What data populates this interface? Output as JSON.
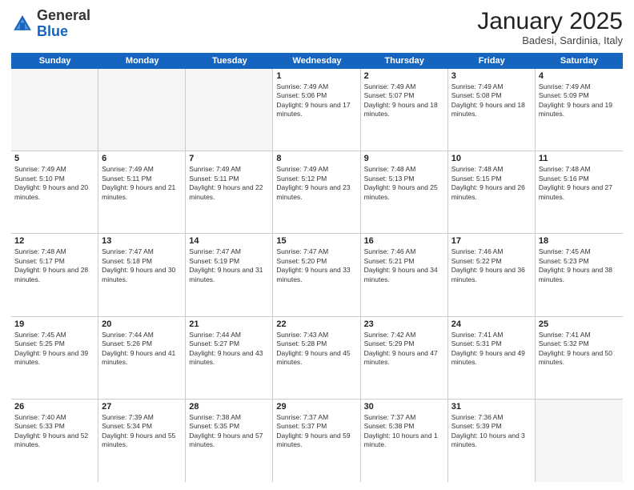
{
  "header": {
    "logo": {
      "general": "General",
      "blue": "Blue"
    },
    "month": "January 2025",
    "location": "Badesi, Sardinia, Italy"
  },
  "days": [
    "Sunday",
    "Monday",
    "Tuesday",
    "Wednesday",
    "Thursday",
    "Friday",
    "Saturday"
  ],
  "weeks": [
    [
      {
        "day": "",
        "empty": true
      },
      {
        "day": "",
        "empty": true
      },
      {
        "day": "",
        "empty": true
      },
      {
        "day": "1",
        "sunrise": "Sunrise: 7:49 AM",
        "sunset": "Sunset: 5:06 PM",
        "daylight": "Daylight: 9 hours and 17 minutes."
      },
      {
        "day": "2",
        "sunrise": "Sunrise: 7:49 AM",
        "sunset": "Sunset: 5:07 PM",
        "daylight": "Daylight: 9 hours and 18 minutes."
      },
      {
        "day": "3",
        "sunrise": "Sunrise: 7:49 AM",
        "sunset": "Sunset: 5:08 PM",
        "daylight": "Daylight: 9 hours and 18 minutes."
      },
      {
        "day": "4",
        "sunrise": "Sunrise: 7:49 AM",
        "sunset": "Sunset: 5:09 PM",
        "daylight": "Daylight: 9 hours and 19 minutes."
      }
    ],
    [
      {
        "day": "5",
        "sunrise": "Sunrise: 7:49 AM",
        "sunset": "Sunset: 5:10 PM",
        "daylight": "Daylight: 9 hours and 20 minutes."
      },
      {
        "day": "6",
        "sunrise": "Sunrise: 7:49 AM",
        "sunset": "Sunset: 5:11 PM",
        "daylight": "Daylight: 9 hours and 21 minutes."
      },
      {
        "day": "7",
        "sunrise": "Sunrise: 7:49 AM",
        "sunset": "Sunset: 5:11 PM",
        "daylight": "Daylight: 9 hours and 22 minutes."
      },
      {
        "day": "8",
        "sunrise": "Sunrise: 7:49 AM",
        "sunset": "Sunset: 5:12 PM",
        "daylight": "Daylight: 9 hours and 23 minutes."
      },
      {
        "day": "9",
        "sunrise": "Sunrise: 7:48 AM",
        "sunset": "Sunset: 5:13 PM",
        "daylight": "Daylight: 9 hours and 25 minutes."
      },
      {
        "day": "10",
        "sunrise": "Sunrise: 7:48 AM",
        "sunset": "Sunset: 5:15 PM",
        "daylight": "Daylight: 9 hours and 26 minutes."
      },
      {
        "day": "11",
        "sunrise": "Sunrise: 7:48 AM",
        "sunset": "Sunset: 5:16 PM",
        "daylight": "Daylight: 9 hours and 27 minutes."
      }
    ],
    [
      {
        "day": "12",
        "sunrise": "Sunrise: 7:48 AM",
        "sunset": "Sunset: 5:17 PM",
        "daylight": "Daylight: 9 hours and 28 minutes."
      },
      {
        "day": "13",
        "sunrise": "Sunrise: 7:47 AM",
        "sunset": "Sunset: 5:18 PM",
        "daylight": "Daylight: 9 hours and 30 minutes."
      },
      {
        "day": "14",
        "sunrise": "Sunrise: 7:47 AM",
        "sunset": "Sunset: 5:19 PM",
        "daylight": "Daylight: 9 hours and 31 minutes."
      },
      {
        "day": "15",
        "sunrise": "Sunrise: 7:47 AM",
        "sunset": "Sunset: 5:20 PM",
        "daylight": "Daylight: 9 hours and 33 minutes."
      },
      {
        "day": "16",
        "sunrise": "Sunrise: 7:46 AM",
        "sunset": "Sunset: 5:21 PM",
        "daylight": "Daylight: 9 hours and 34 minutes."
      },
      {
        "day": "17",
        "sunrise": "Sunrise: 7:46 AM",
        "sunset": "Sunset: 5:22 PM",
        "daylight": "Daylight: 9 hours and 36 minutes."
      },
      {
        "day": "18",
        "sunrise": "Sunrise: 7:45 AM",
        "sunset": "Sunset: 5:23 PM",
        "daylight": "Daylight: 9 hours and 38 minutes."
      }
    ],
    [
      {
        "day": "19",
        "sunrise": "Sunrise: 7:45 AM",
        "sunset": "Sunset: 5:25 PM",
        "daylight": "Daylight: 9 hours and 39 minutes."
      },
      {
        "day": "20",
        "sunrise": "Sunrise: 7:44 AM",
        "sunset": "Sunset: 5:26 PM",
        "daylight": "Daylight: 9 hours and 41 minutes."
      },
      {
        "day": "21",
        "sunrise": "Sunrise: 7:44 AM",
        "sunset": "Sunset: 5:27 PM",
        "daylight": "Daylight: 9 hours and 43 minutes."
      },
      {
        "day": "22",
        "sunrise": "Sunrise: 7:43 AM",
        "sunset": "Sunset: 5:28 PM",
        "daylight": "Daylight: 9 hours and 45 minutes."
      },
      {
        "day": "23",
        "sunrise": "Sunrise: 7:42 AM",
        "sunset": "Sunset: 5:29 PM",
        "daylight": "Daylight: 9 hours and 47 minutes."
      },
      {
        "day": "24",
        "sunrise": "Sunrise: 7:41 AM",
        "sunset": "Sunset: 5:31 PM",
        "daylight": "Daylight: 9 hours and 49 minutes."
      },
      {
        "day": "25",
        "sunrise": "Sunrise: 7:41 AM",
        "sunset": "Sunset: 5:32 PM",
        "daylight": "Daylight: 9 hours and 50 minutes."
      }
    ],
    [
      {
        "day": "26",
        "sunrise": "Sunrise: 7:40 AM",
        "sunset": "Sunset: 5:33 PM",
        "daylight": "Daylight: 9 hours and 52 minutes."
      },
      {
        "day": "27",
        "sunrise": "Sunrise: 7:39 AM",
        "sunset": "Sunset: 5:34 PM",
        "daylight": "Daylight: 9 hours and 55 minutes."
      },
      {
        "day": "28",
        "sunrise": "Sunrise: 7:38 AM",
        "sunset": "Sunset: 5:35 PM",
        "daylight": "Daylight: 9 hours and 57 minutes."
      },
      {
        "day": "29",
        "sunrise": "Sunrise: 7:37 AM",
        "sunset": "Sunset: 5:37 PM",
        "daylight": "Daylight: 9 hours and 59 minutes."
      },
      {
        "day": "30",
        "sunrise": "Sunrise: 7:37 AM",
        "sunset": "Sunset: 5:38 PM",
        "daylight": "Daylight: 10 hours and 1 minute."
      },
      {
        "day": "31",
        "sunrise": "Sunrise: 7:36 AM",
        "sunset": "Sunset: 5:39 PM",
        "daylight": "Daylight: 10 hours and 3 minutes."
      },
      {
        "day": "",
        "empty": true
      }
    ]
  ]
}
